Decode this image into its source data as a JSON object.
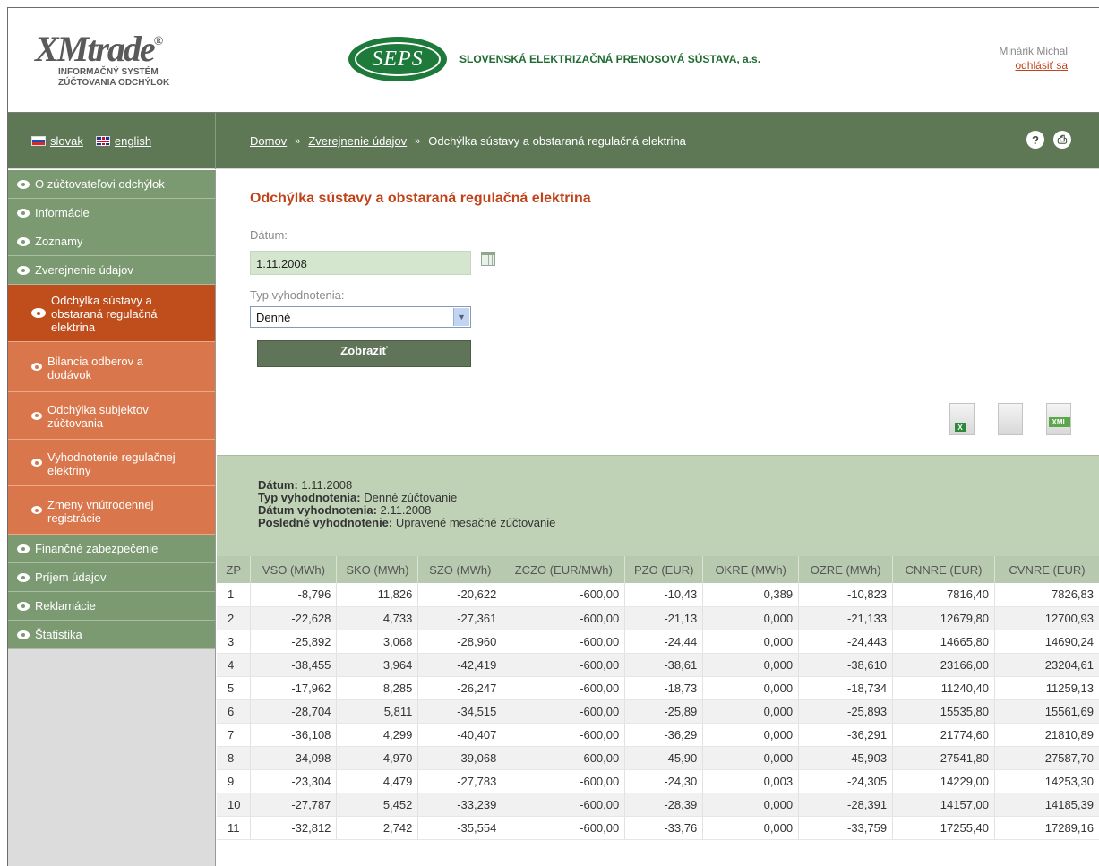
{
  "header": {
    "brand": "XMtrade",
    "brand_mark": "®",
    "brand_sub1": "INFORMAČNÝ SYSTÉM",
    "brand_sub2": "ZÚČTOVANIA ODCHÝLOK",
    "sepos_logo_text": "SEPS",
    "sepos_name": "SLOVENSKÁ ELEKTRIZAČNÁ PRENOSOVÁ SÚSTAVA, a.s.",
    "user_name": "Minárik Michal",
    "logout": "odhlásiť sa"
  },
  "topbar": {
    "lang_sk": "slovak",
    "lang_en": "english",
    "crumb_home": "Domov",
    "crumb_publish": "Zverejnenie údajov",
    "crumb_current": "Odchýlka sústavy a obstaraná regulačná elektrina",
    "sep": "»",
    "help_icon": "?",
    "print_icon": "⎙"
  },
  "sidebar": {
    "items": [
      {
        "label": "O zúčtovateľovi odchýlok"
      },
      {
        "label": "Informácie"
      },
      {
        "label": "Zoznamy"
      },
      {
        "label": "Zverejnenie údajov"
      }
    ],
    "subitems": [
      {
        "label": "Odchýlka sústavy a obstaraná regulačná elektrina"
      },
      {
        "label": "Bilancia odberov a dodávok"
      },
      {
        "label": "Odchýlka subjektov zúčtovania"
      },
      {
        "label": "Vyhodnotenie regulačnej elektriny"
      },
      {
        "label": "Zmeny vnútrodennej registrácie"
      }
    ],
    "items2": [
      {
        "label": "Finančné zabezpečenie"
      },
      {
        "label": "Príjem údajov"
      },
      {
        "label": "Reklamácie"
      },
      {
        "label": "Štatistika"
      }
    ]
  },
  "main": {
    "title": "Odchýlka sústavy a obstaraná regulačná elektrina",
    "date_label": "Dátum:",
    "date_value": "1.11.2008",
    "type_label": "Typ vyhodnotenia:",
    "type_value": "Denné",
    "show_button": "Zobraziť",
    "summary": {
      "date_label": "Dátum:",
      "date_value": " 1.11.2008",
      "type_label": "Typ vyhodnotenia:",
      "type_value": " Denné zúčtovanie",
      "eval_label": "Dátum vyhodnotenia:",
      "eval_value": " 2.11.2008",
      "last_label": "Posledné vyhodnotenie:",
      "last_value": " Upravené mesačné zúčtovanie"
    },
    "table": {
      "columns": [
        "ZP",
        "VSO (MWh)",
        "SKO (MWh)",
        "SZO (MWh)",
        "ZCZO (EUR/MWh)",
        "PZO (EUR)",
        "OKRE (MWh)",
        "OZRE (MWh)",
        "CNNRE (EUR)",
        "CVNRE (EUR)"
      ],
      "rows": [
        [
          "1",
          "-8,796",
          "11,826",
          "-20,622",
          "-600,00",
          "-10,43",
          "0,389",
          "-10,823",
          "7816,40",
          "7826,83"
        ],
        [
          "2",
          "-22,628",
          "4,733",
          "-27,361",
          "-600,00",
          "-21,13",
          "0,000",
          "-21,133",
          "12679,80",
          "12700,93"
        ],
        [
          "3",
          "-25,892",
          "3,068",
          "-28,960",
          "-600,00",
          "-24,44",
          "0,000",
          "-24,443",
          "14665,80",
          "14690,24"
        ],
        [
          "4",
          "-38,455",
          "3,964",
          "-42,419",
          "-600,00",
          "-38,61",
          "0,000",
          "-38,610",
          "23166,00",
          "23204,61"
        ],
        [
          "5",
          "-17,962",
          "8,285",
          "-26,247",
          "-600,00",
          "-18,73",
          "0,000",
          "-18,734",
          "11240,40",
          "11259,13"
        ],
        [
          "6",
          "-28,704",
          "5,811",
          "-34,515",
          "-600,00",
          "-25,89",
          "0,000",
          "-25,893",
          "15535,80",
          "15561,69"
        ],
        [
          "7",
          "-36,108",
          "4,299",
          "-40,407",
          "-600,00",
          "-36,29",
          "0,000",
          "-36,291",
          "21774,60",
          "21810,89"
        ],
        [
          "8",
          "-34,098",
          "4,970",
          "-39,068",
          "-600,00",
          "-45,90",
          "0,000",
          "-45,903",
          "27541,80",
          "27587,70"
        ],
        [
          "9",
          "-23,304",
          "4,479",
          "-27,783",
          "-600,00",
          "-24,30",
          "0,003",
          "-24,305",
          "14229,00",
          "14253,30"
        ],
        [
          "10",
          "-27,787",
          "5,452",
          "-33,239",
          "-600,00",
          "-28,39",
          "0,000",
          "-28,391",
          "14157,00",
          "14185,39"
        ],
        [
          "11",
          "-32,812",
          "2,742",
          "-35,554",
          "-600,00",
          "-33,76",
          "0,000",
          "-33,759",
          "17255,40",
          "17289,16"
        ]
      ]
    },
    "exports": [
      {
        "name": "excel-export-icon",
        "badge": "X"
      },
      {
        "name": "csv-export-icon",
        "badge": ""
      },
      {
        "name": "xml-export-icon",
        "badge": "XML"
      }
    ]
  }
}
